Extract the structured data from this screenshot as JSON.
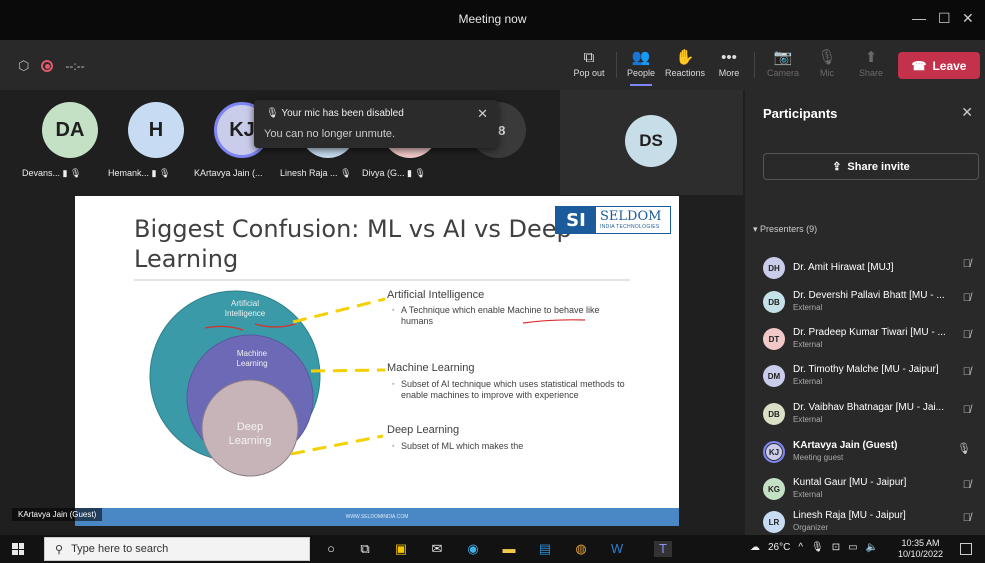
{
  "window": {
    "title": "Meeting now",
    "controls": [
      "—",
      "☐",
      "✕"
    ]
  },
  "toolbar": {
    "timer": "--:--",
    "buttons": [
      {
        "label": "Pop out",
        "icon": "⧉"
      },
      {
        "label": "People",
        "icon": "👥"
      },
      {
        "label": "Reactions",
        "icon": "✋"
      },
      {
        "label": "More",
        "icon": "•••"
      },
      {
        "label": "Camera",
        "icon": "📷"
      },
      {
        "label": "Mic",
        "icon": "🎙"
      },
      {
        "label": "Share",
        "icon": "⬆"
      }
    ],
    "leave_label": "Leave"
  },
  "gallery": {
    "tiles": [
      {
        "initials": "DA",
        "name": "Devans...",
        "color": "#c5e1c5"
      },
      {
        "initials": "H",
        "name": "Hemank...",
        "color": "#c7dcf2"
      },
      {
        "initials": "KJ",
        "name": "KArtavya Jain (...",
        "color": "#c9cdea"
      },
      {
        "initials": "",
        "name": "Linesh Raja ...",
        "color": "#c7dcf2"
      },
      {
        "initials": "",
        "name": "Divya (G...",
        "color": "#f2c9c9"
      }
    ],
    "overflow_count": "+8",
    "spotlight_initials": "DS"
  },
  "toast": {
    "title": "Your mic has been disabled",
    "message": "You can no longer unmute."
  },
  "slide": {
    "title": "Biggest Confusion: ML vs AI vs Deep Learning",
    "logo_mark": "SI",
    "logo_name": "SELDOM",
    "logo_sub": "INDIA TECHNOLOGIES",
    "circle_labels": {
      "ai": "Artificial Intelligence",
      "ml": "Machine Learning",
      "dl": "Deep Learning"
    },
    "sections": [
      {
        "heading": "Artificial Intelligence",
        "bullet": "A Technique which enable Machine to behave like humans"
      },
      {
        "heading": "Machine Learning",
        "bullet": "Subset of AI technique which uses statistical methods to enable machines to improve with experience"
      },
      {
        "heading": "Deep Learning",
        "bullet": "Subset of ML which makes the"
      }
    ],
    "footer": "WWW.SELDOMINDIA.COM"
  },
  "caption": "KArtavya Jain (Guest)",
  "participants": {
    "header": "Participants",
    "share_invite": "Share invite",
    "section": "Presenters (9)",
    "list": [
      {
        "initials": "DH",
        "name": "Dr. Amit Hirawat [MUJ]",
        "sub": "",
        "color": "#c9cdea",
        "mic": "muted"
      },
      {
        "initials": "DB",
        "name": "Dr. Devershi Pallavi Bhatt [MU - ...",
        "sub": "External",
        "color": "#c5e1e8",
        "mic": "muted"
      },
      {
        "initials": "DT",
        "name": "Dr. Pradeep Kumar Tiwari [MU - ...",
        "sub": "External",
        "color": "#f2c9c9",
        "mic": "muted"
      },
      {
        "initials": "DM",
        "name": "Dr. Timothy Malche [MU - Jaipur]",
        "sub": "External",
        "color": "#c9cdea",
        "mic": "muted"
      },
      {
        "initials": "DB",
        "name": "Dr. Vaibhav Bhatnagar [MU - Jai...",
        "sub": "External",
        "color": "#d9e0c5",
        "mic": "muted"
      },
      {
        "initials": "KJ",
        "name": "KArtavya Jain (Guest)",
        "sub": "Meeting guest",
        "color": "#c9cdea",
        "mic": "on"
      },
      {
        "initials": "KG",
        "name": "Kuntal Gaur [MU - Jaipur]",
        "sub": "External",
        "color": "#c5e1c5",
        "mic": "muted"
      },
      {
        "initials": "LR",
        "name": "Linesh Raja [MU - Jaipur]",
        "sub": "Organizer",
        "color": "#c7dcf2",
        "mic": "muted"
      }
    ]
  },
  "taskbar": {
    "search_placeholder": "Type here to search",
    "weather": "26°C",
    "time": "10:35 AM",
    "date": "10/10/2022"
  }
}
